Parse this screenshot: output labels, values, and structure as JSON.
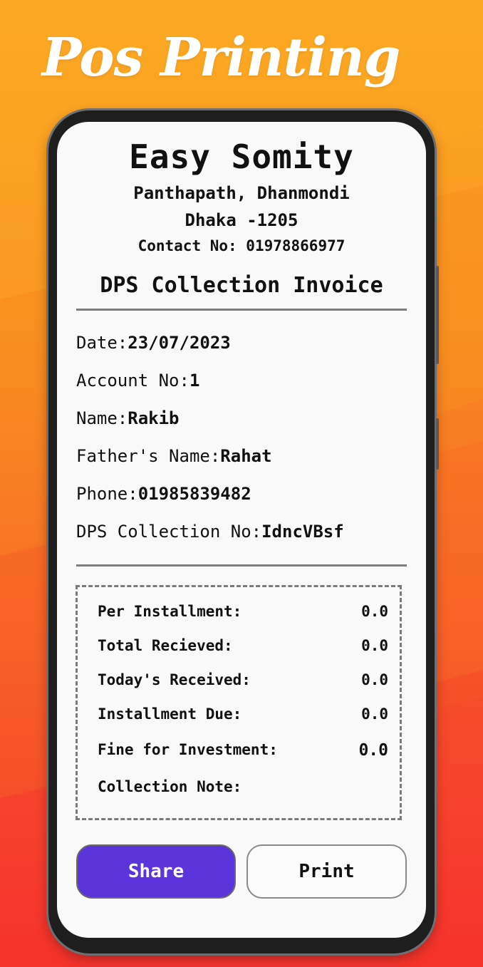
{
  "promo": {
    "headline": "Pos Printing"
  },
  "business": {
    "name": "Easy Somity",
    "address_line1": "Panthapath, Dhanmondi",
    "address_line2": "Dhaka -1205",
    "contact": "Contact No: 01978866977"
  },
  "invoice": {
    "title": "DPS Collection Invoice"
  },
  "details": [
    {
      "label": "Date:",
      "value": "23/07/2023"
    },
    {
      "label": "Account No:",
      "value": "1"
    },
    {
      "label": "Name:",
      "value": "Rakib"
    },
    {
      "label": "Father's Name:",
      "value": "Rahat"
    },
    {
      "label": "Phone:",
      "value": "01985839482"
    },
    {
      "label": "DPS Collection No:",
      "value": "IdncVBsf"
    }
  ],
  "summary": [
    {
      "label": "Per Installment:",
      "value": "0.0"
    },
    {
      "label": "Total Recieved:",
      "value": "0.0"
    },
    {
      "label": "Today's Received:",
      "value": "0.0"
    },
    {
      "label": "Installment Due:",
      "value": "0.0"
    },
    {
      "label": "Fine for Investment:",
      "value": "0.0"
    },
    {
      "label": "Collection Note:",
      "value": ""
    }
  ],
  "actions": {
    "share_label": "Share",
    "print_label": "Print"
  },
  "colors": {
    "accent": "#5b35db",
    "background_top": "#fba51f",
    "background_bottom": "#f52f2c"
  }
}
